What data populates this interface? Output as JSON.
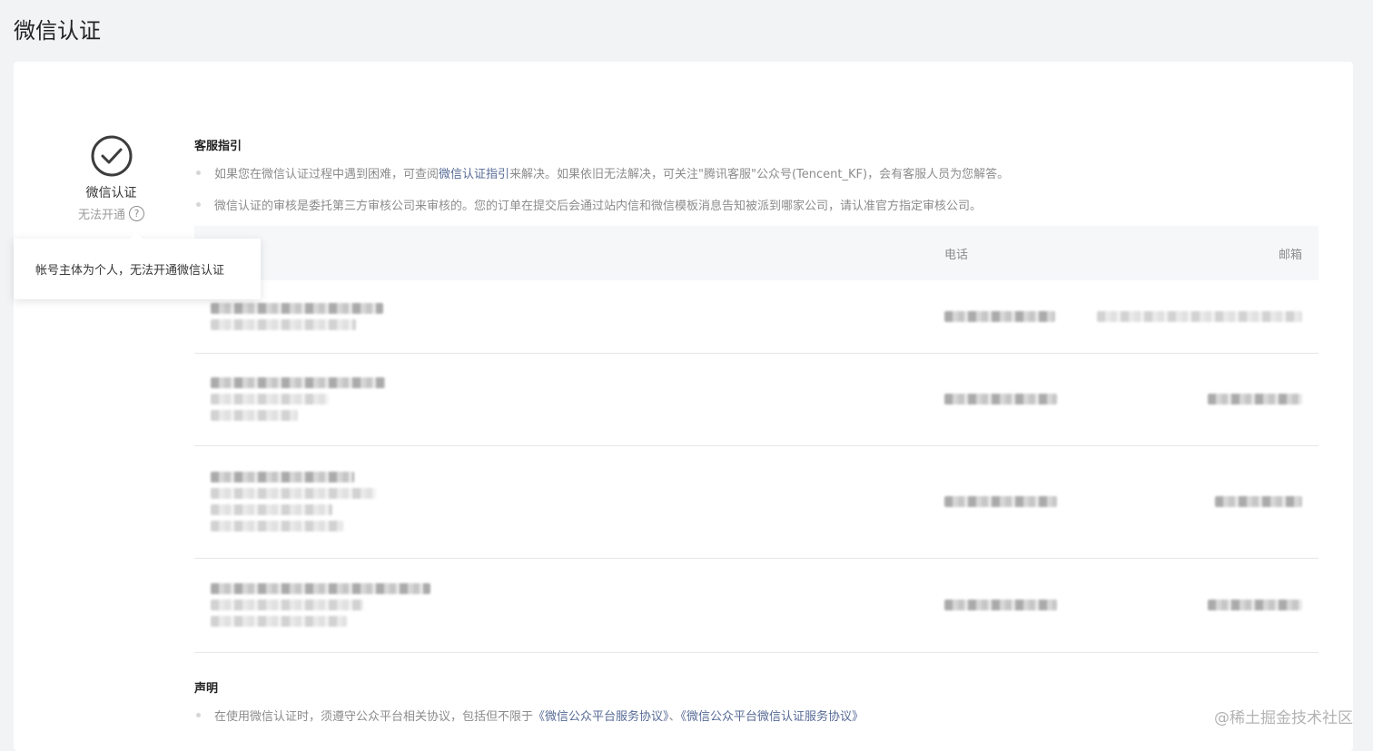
{
  "page": {
    "title": "微信认证"
  },
  "status": {
    "title": "微信认证",
    "subtitle": "无法开通",
    "help_glyph": "?",
    "tooltip": "帐号主体为个人，无法开通微信认证"
  },
  "guide": {
    "title": "客服指引",
    "bullet1_prefix": "如果您在微信认证过程中遇到困难，可查阅",
    "bullet1_link": "微信认证指引",
    "bullet1_suffix": "来解决。如果依旧无法解决，可关注\"腾讯客服\"公众号(Tencent_KF)，会有客服人员为您解答。",
    "bullet2": "微信认证的审核是委托第三方审核公司来审核的。您的订单在提交后会通过站内信和微信模板消息告知被派到哪家公司，请认准官方指定审核公司。"
  },
  "table": {
    "headers": {
      "name": "",
      "phone": "电话",
      "email": "邮箱"
    }
  },
  "statement": {
    "title": "声明",
    "prefix": "在使用微信认证时，须遵守公众平台相关协议，包括但不限于",
    "link1": "《微信公众平台服务协议》",
    "sep": "、",
    "link2": "《微信公众平台微信认证服务协议》"
  },
  "watermark": "@稀土掘金技术社区",
  "colors": {
    "link": "#576b95",
    "background": "#f2f3f5",
    "card": "#ffffff"
  },
  "icons": {
    "status": "check-circle-icon",
    "help": "question-circle-icon"
  }
}
